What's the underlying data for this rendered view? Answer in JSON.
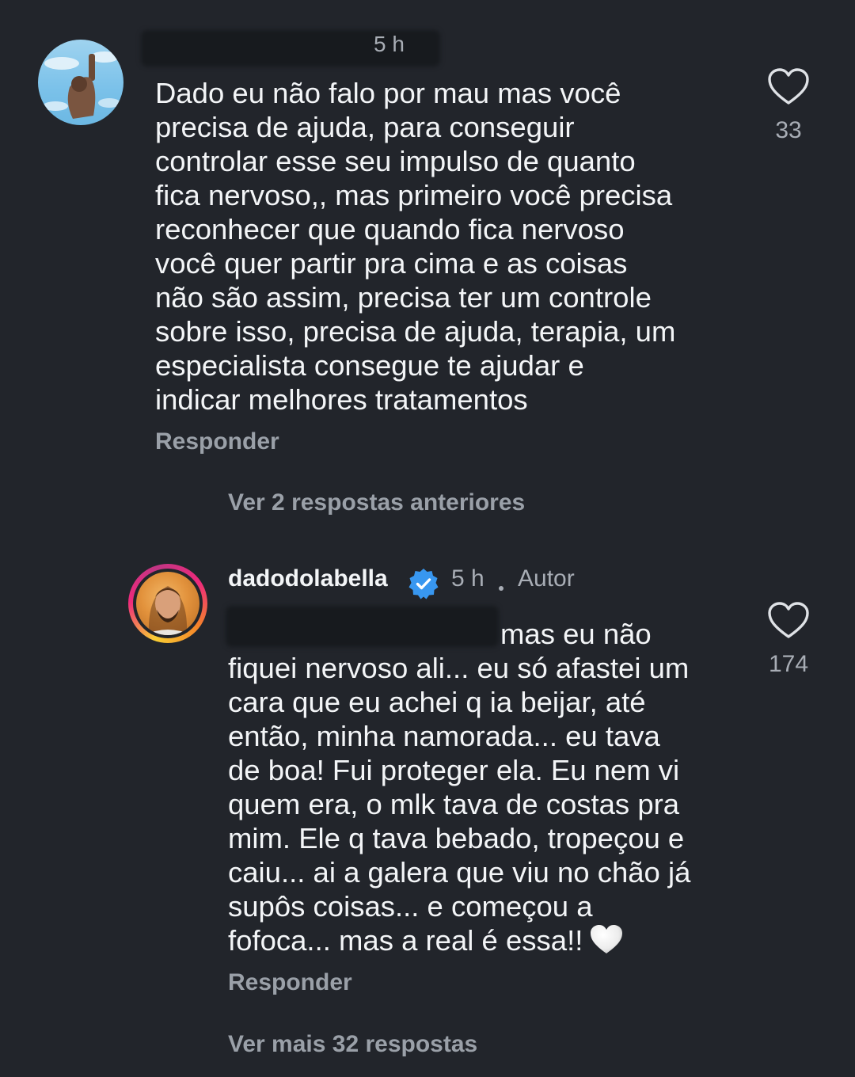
{
  "comment_1": {
    "timestamp": "5 h",
    "text": "Dado eu não falo por mau mas você\nprecisa de ajuda, para conseguir\ncontrolar esse seu impulso de quanto\nfica nervoso,, mas primeiro você precisa\nreconhecer que quando fica nervoso\nvocê quer partir pra cima e as coisas\nnão são assim, precisa ter um controle\nsobre isso, precisa de ajuda, terapia, um\nespecialista consegue te ajudar e\nindicar melhores tratamentos",
    "reply_label": "Responder",
    "like_count": "33",
    "like_icon": "heart-outline-icon"
  },
  "view_previous_replies": "Ver 2 respostas anteriores",
  "comment_2": {
    "username": "dadodolabella",
    "verified_icon": "verified-badge-icon",
    "timestamp": "5 h",
    "author_label": "Autor",
    "text": "mas eu não\nfiquei nervoso ali... eu só afastei um\ncara que eu achei q ia beijar, até\nentão, minha namorada... eu tava\nde boa! Fui proteger ela. Eu nem vi\nquem era, o mlk tava de costas pra\nmim. Ele q tava bebado, tropeçou e\ncaiu... ai a galera que viu no chão já\nsupôs coisas... e começou a\nfofoca... mas a real é essa!!",
    "emoji": "white-heart-emoji",
    "reply_label": "Responder",
    "like_count": "174",
    "like_icon": "heart-outline-icon"
  },
  "view_more_replies": "Ver mais 32 respostas",
  "colors": {
    "background": "#22252b",
    "primary_text": "#f3f5f7",
    "secondary_text": "#a8adb5",
    "verified_blue": "#3897f0"
  }
}
